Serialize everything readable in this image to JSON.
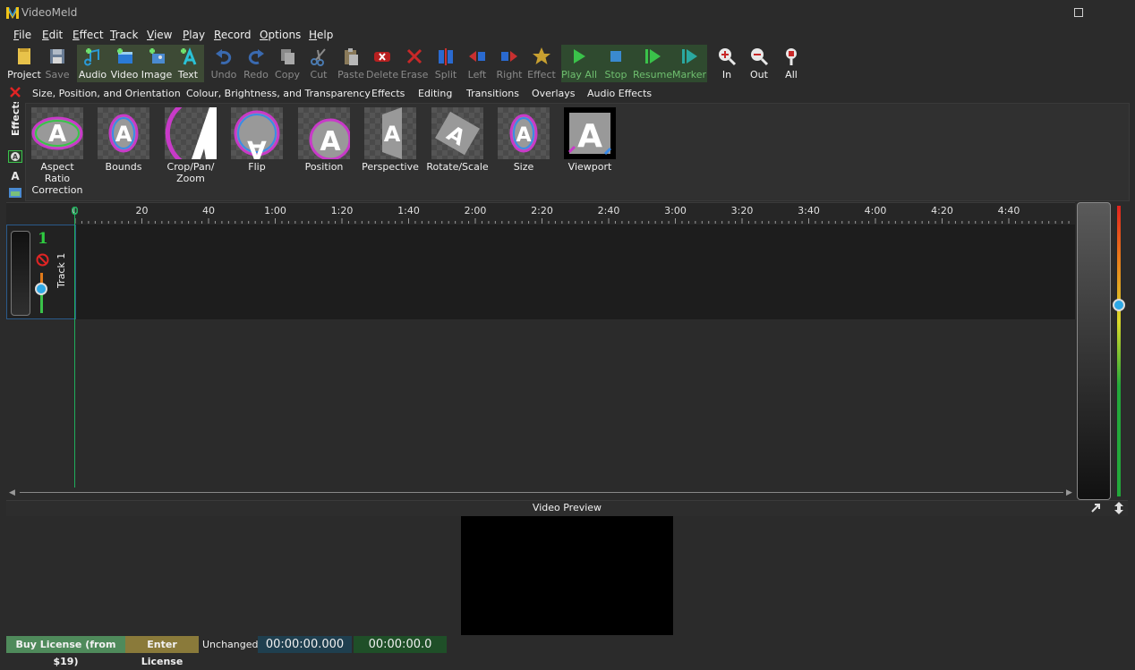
{
  "app": {
    "title": "VideoMeld"
  },
  "menu": [
    "File",
    "Edit",
    "Effect",
    "Track",
    "View",
    "Play",
    "Record",
    "Options",
    "Help"
  ],
  "toolbar": {
    "project": "Project",
    "save": "Save",
    "audio": "Audio",
    "video": "Video",
    "image": "Image",
    "text": "Text",
    "undo": "Undo",
    "redo": "Redo",
    "copy": "Copy",
    "cut": "Cut",
    "paste": "Paste",
    "delete": "Delete",
    "erase": "Erase",
    "split": "Split",
    "left": "Left",
    "right": "Right",
    "effect": "Effect",
    "play_all": "Play All",
    "stop": "Stop",
    "resume": "Resume",
    "marker": "Marker",
    "zoom_in": "In",
    "zoom_out": "Out",
    "zoom_all": "All"
  },
  "effect_tabs": [
    "Size, Position, and Orientation",
    "Colour, Brightness, and Transparency",
    "Effects",
    "Editing",
    "Transitions",
    "Overlays",
    "Audio Effects"
  ],
  "effects_panel_label": "Effects",
  "effects": [
    {
      "label": "Aspect Ratio Correction"
    },
    {
      "label": "Bounds"
    },
    {
      "label": "Crop/Pan/ Zoom"
    },
    {
      "label": "Flip"
    },
    {
      "label": "Position"
    },
    {
      "label": "Perspective"
    },
    {
      "label": "Rotate/Scale"
    },
    {
      "label": "Size"
    },
    {
      "label": "Viewport"
    }
  ],
  "ruler": {
    "labels": [
      "0",
      "20",
      "40",
      "1:00",
      "1:20",
      "1:40",
      "2:00",
      "2:20",
      "2:40",
      "3:00",
      "3:20",
      "3:40",
      "4:00",
      "4:20",
      "4:40"
    ]
  },
  "track": {
    "number": "1",
    "name": "Track 1"
  },
  "preview": {
    "label": "Video Preview"
  },
  "status": {
    "buy_license": "Buy License (from $19)",
    "enter_license": "Enter License",
    "state": "Unchanged",
    "timecode_position": "00:00:00.000",
    "timecode_duration": "00:00:00.0"
  }
}
